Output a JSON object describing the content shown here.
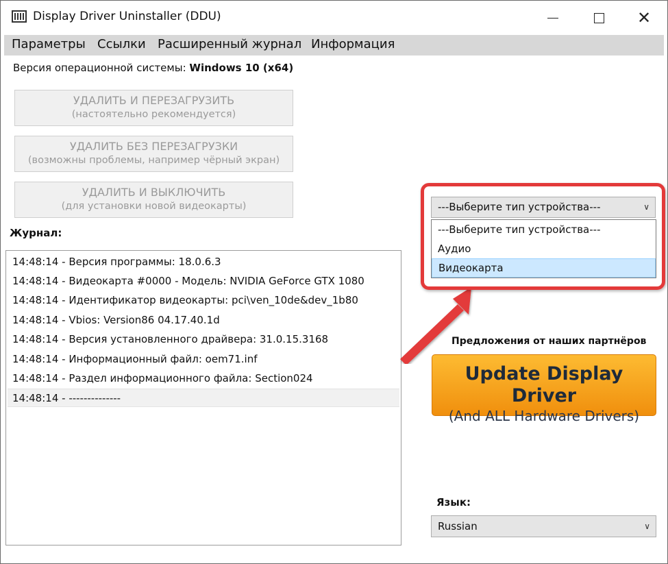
{
  "window": {
    "title": "Display Driver Uninstaller (DDU)"
  },
  "menu": {
    "items": [
      "Параметры",
      "Ссылки",
      "Расширенный журнал",
      "Информация"
    ]
  },
  "os": {
    "label": "Версия операционной системы:",
    "value": "Windows 10 (x64)"
  },
  "actions": [
    {
      "line1": "УДАЛИТЬ И ПЕРЕЗАГРУЗИТЬ",
      "line2": "(настоятельно рекомендуется)"
    },
    {
      "line1": "УДАЛИТЬ БЕЗ ПЕРЕЗАГРУЗКИ",
      "line2": "(возможны проблемы, например чёрный экран)"
    },
    {
      "line1": "УДАЛИТЬ И ВЫКЛЮЧИТЬ",
      "line2": "(для установки новой видеокарты)"
    }
  ],
  "log": {
    "title": "Журнал:",
    "lines": [
      "14:48:14 - Версия программы: 18.0.6.3",
      "14:48:14 - Видеокарта #0000 - Модель: NVIDIA GeForce GTX 1080",
      "14:48:14 - Идентификатор видеокарты: pci\\ven_10de&dev_1b80",
      "14:48:14 - Vbios: Version86 04.17.40.1d",
      "14:48:14 - Версия установленного драйвера: 31.0.15.3168",
      "14:48:14 - Информационный файл: oem71.inf",
      "14:48:14 - Раздел информационного файла: Section024",
      "14:48:14 - --------------"
    ]
  },
  "device_type": {
    "selected": "---Выберите тип устройства---",
    "options": [
      "---Выберите тип устройства---",
      "Аудио",
      "Видеокарта"
    ],
    "hovered_option": "Видеокарта"
  },
  "partners": {
    "title": "Предложения от наших партнёров",
    "promo_line1": "Update Display Driver",
    "promo_line2": "(And ALL Hardware Drivers)"
  },
  "language": {
    "label": "Язык:",
    "selected": "Russian"
  },
  "colors": {
    "highlight": "#e33a3a",
    "promo_top": "#fdbb32",
    "promo_bottom": "#f08f0d",
    "hover": "#cce8ff"
  }
}
